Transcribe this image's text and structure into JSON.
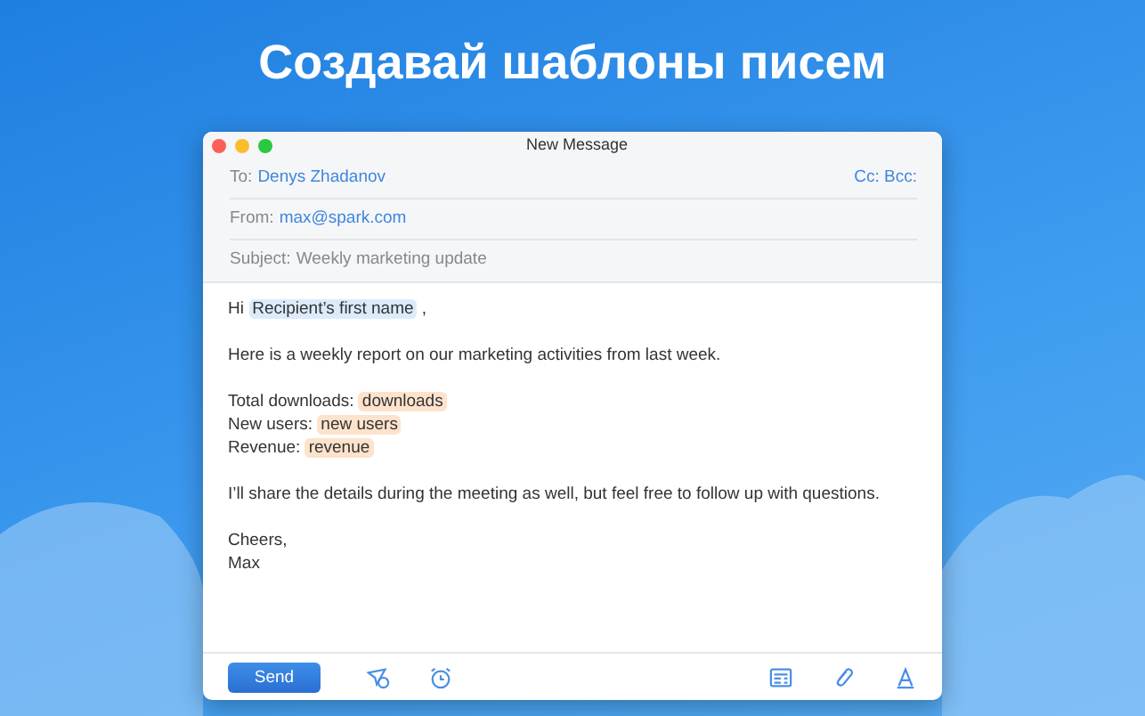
{
  "headline": "Создавай шаблоны писем",
  "window": {
    "title": "New Message"
  },
  "header": {
    "to_label": "To:",
    "to": "Denys Zhadanov",
    "cc_bcc": "Cc: Bcc:",
    "from_label": "From:",
    "from": "max@spark.com",
    "subject_label": "Subject:",
    "subject": "Weekly marketing update"
  },
  "body": [
    [
      [
        {
          "kind": "text",
          "text": "Hi"
        },
        {
          "kind": "placeholder",
          "text": "Recipient’s first name",
          "color": "#dcebfb"
        },
        {
          "kind": "text",
          "text": ","
        }
      ]
    ],
    [
      [
        {
          "kind": "text",
          "text": "Here is a weekly report on our marketing activities from last week."
        }
      ]
    ],
    [
      [
        {
          "kind": "text",
          "text": "Total downloads:"
        },
        {
          "kind": "placeholder",
          "text": "downloads",
          "color": "#fde3cc"
        }
      ],
      [
        {
          "kind": "text",
          "text": "New users:"
        },
        {
          "kind": "placeholder",
          "text": "new users",
          "color": "#fde3cc"
        }
      ],
      [
        {
          "kind": "text",
          "text": "Revenue:"
        },
        {
          "kind": "placeholder",
          "text": "revenue",
          "color": "#fde3cc"
        }
      ]
    ],
    [
      [
        {
          "kind": "text",
          "text": "I’ll share the details during the meeting as well, but feel free to follow up with questions."
        }
      ]
    ],
    [
      [
        {
          "kind": "text",
          "text": "Cheers,"
        }
      ],
      [
        {
          "kind": "text",
          "text": "Max"
        }
      ]
    ]
  ],
  "toolbar": {
    "send": "Send"
  }
}
